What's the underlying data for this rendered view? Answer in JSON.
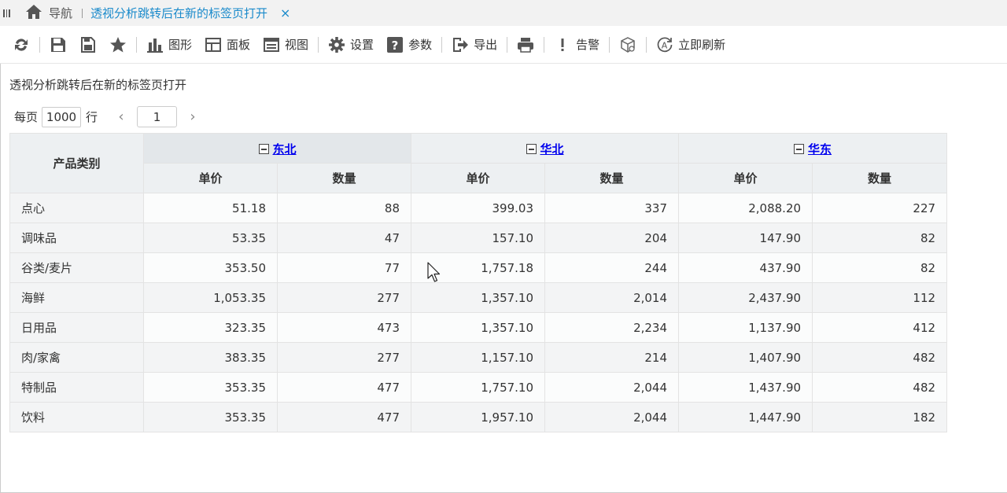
{
  "tabs": {
    "home_label": "导航",
    "active_label": "透视分析跳转后在新的标签页打开",
    "close_glyph": "×"
  },
  "toolbar": {
    "chart_label": "图形",
    "panel_label": "面板",
    "view_label": "视图",
    "settings_label": "设置",
    "params_label": "参数",
    "export_label": "导出",
    "alert_label": "告警",
    "refresh_label": "立即刷新"
  },
  "report": {
    "title": "透视分析跳转后在新的标签页打开",
    "pager": {
      "per_page_label": "每页",
      "per_page_value": "1000",
      "rows_label": "行",
      "page_value": "1",
      "prev_glyph": "‹",
      "next_glyph": "›"
    },
    "table": {
      "row_header": "产品类别",
      "regions": [
        "东北",
        "华北",
        "华东"
      ],
      "measures": [
        "单价",
        "数量"
      ],
      "rows": [
        {
          "category": "点心",
          "values": [
            "51.18",
            "88",
            "399.03",
            "337",
            "2,088.20",
            "227"
          ]
        },
        {
          "category": "调味品",
          "values": [
            "53.35",
            "47",
            "157.10",
            "204",
            "147.90",
            "82"
          ]
        },
        {
          "category": "谷类/麦片",
          "values": [
            "353.50",
            "77",
            "1,757.18",
            "244",
            "437.90",
            "82"
          ]
        },
        {
          "category": "海鲜",
          "values": [
            "1,053.35",
            "277",
            "1,357.10",
            "2,014",
            "2,437.90",
            "112"
          ]
        },
        {
          "category": "日用品",
          "values": [
            "323.35",
            "473",
            "1,357.10",
            "2,234",
            "1,137.90",
            "412"
          ]
        },
        {
          "category": "肉/家禽",
          "values": [
            "383.35",
            "277",
            "1,157.10",
            "214",
            "1,407.90",
            "482"
          ]
        },
        {
          "category": "特制品",
          "values": [
            "353.35",
            "477",
            "1,757.10",
            "2,044",
            "1,437.90",
            "482"
          ]
        },
        {
          "category": "饮料",
          "values": [
            "353.35",
            "477",
            "1,957.10",
            "2,044",
            "1,447.90",
            "182"
          ]
        }
      ]
    }
  },
  "colors": {
    "tab_active": "#1a8acb",
    "link": "#0000ee",
    "header_bg": "#edf0f2",
    "icon_gray": "#555555"
  },
  "icons": {
    "toolbar": [
      "refresh-icon",
      "save-icon",
      "save-as-icon",
      "favorite-icon",
      "chart-icon",
      "panel-icon",
      "view-icon",
      "gear-icon",
      "help-icon",
      "export-icon",
      "print-icon",
      "alert-icon",
      "cube-icon",
      "auto-refresh-icon"
    ]
  }
}
